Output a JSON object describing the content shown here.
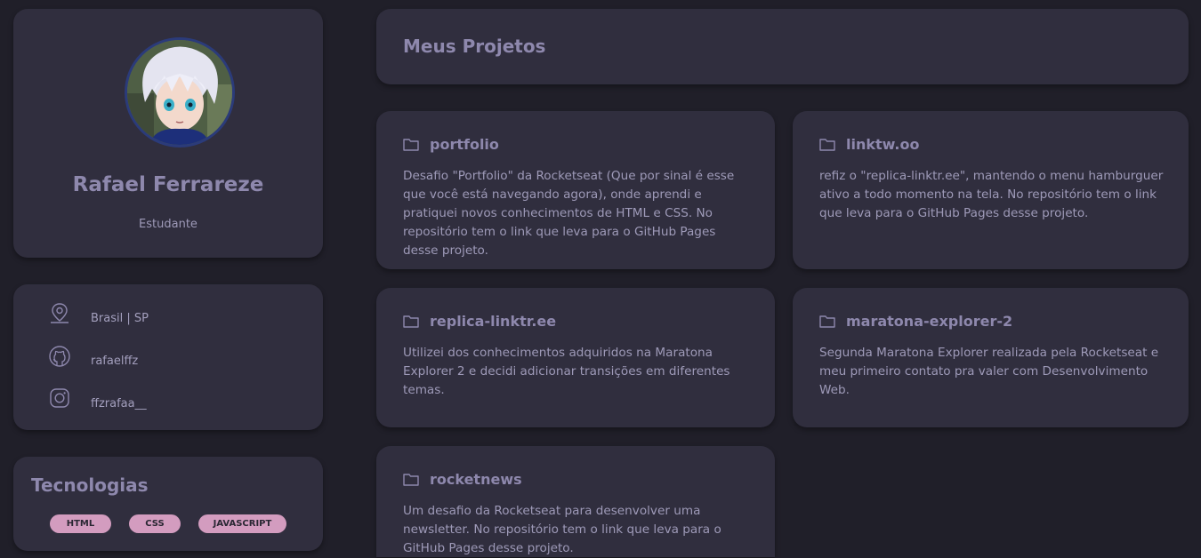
{
  "profile": {
    "name": "Rafael Ferrareze",
    "role": "Estudante"
  },
  "info": {
    "location": "Brasil | SP",
    "github": "rafaelffz",
    "instagram": "ffzrafaa__"
  },
  "technologies": {
    "title": "Tecnologias",
    "tags": [
      "HTML",
      "CSS",
      "JAVASCRIPT"
    ]
  },
  "projects": {
    "title": "Meus Projetos",
    "items": [
      {
        "name": "portfolio",
        "description": "Desafio \"Portfolio\" da Rocketseat (Que por sinal é esse que você está navegando agora), onde aprendi e pratiquei novos conhecimentos de HTML e CSS. No repositório tem o link que leva para o GitHub Pages desse projeto."
      },
      {
        "name": "linktw.oo",
        "description": "refiz o \"replica-linktr.ee\", mantendo o menu hamburguer ativo a todo momento na tela. No repositório tem o link que leva para o GitHub Pages desse projeto."
      },
      {
        "name": "replica-linktr.ee",
        "description": "Utilizei dos conhecimentos adquiridos na Maratona Explorer 2 e decidi adicionar transições em diferentes temas."
      },
      {
        "name": "maratona-explorer-2",
        "description": "Segunda Maratona Explorer realizada pela Rocketseat e meu primeiro contato pra valer com Desenvolvimento Web."
      },
      {
        "name": "rocketnews",
        "description": "Um desafio da Rocketseat para desenvolver uma newsletter. No repositório tem o link que leva para o GitHub Pages desse projeto."
      }
    ]
  },
  "colors": {
    "background": "#201f29",
    "card": "#302e3e",
    "heading": "#8e88ad",
    "text": "#9e9ab8",
    "tag": "#d39cbf"
  }
}
